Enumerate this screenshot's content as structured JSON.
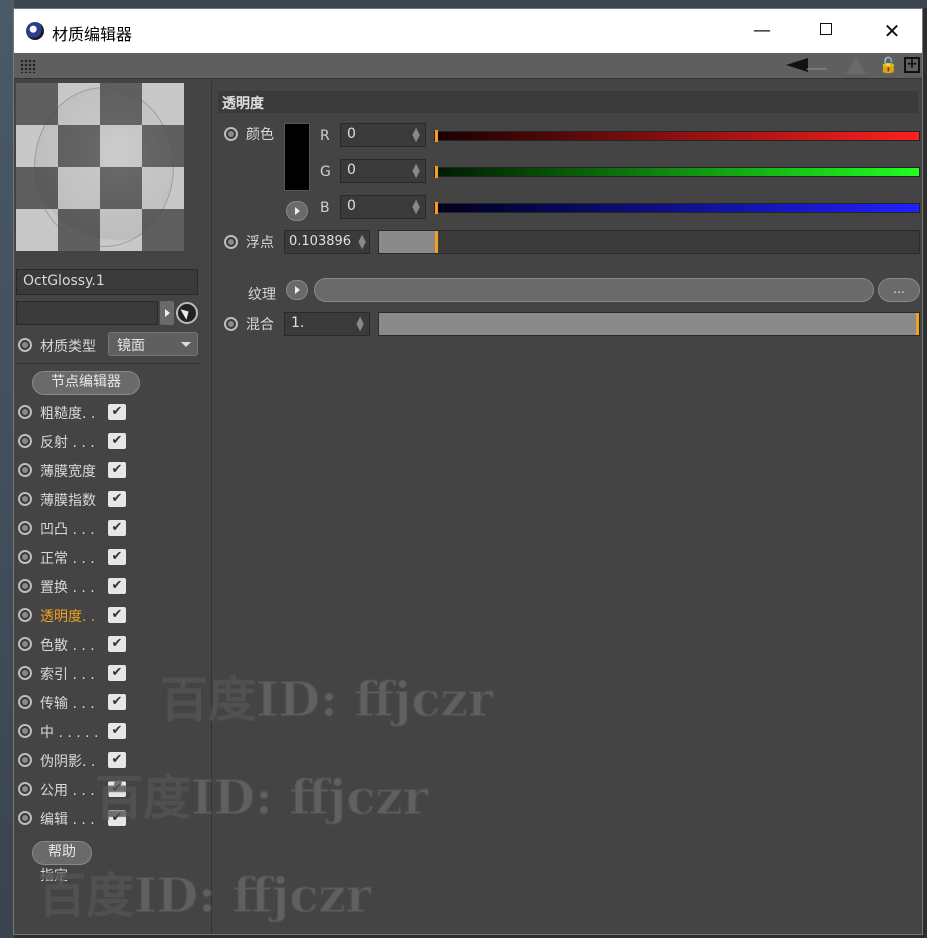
{
  "window": {
    "title": "材质编辑器",
    "minimize": "—",
    "close": "✕"
  },
  "toolbar": {
    "icons": [
      "grip-icon",
      "back-arrow-icon",
      "up-arrow-icon",
      "lock-icon",
      "new-window-icon"
    ]
  },
  "material": {
    "name": "OctGlossy.1",
    "type_label": "材质类型",
    "type_value": "镜面",
    "node_editor_button": "节点编辑器"
  },
  "channels": [
    {
      "label": "粗糙度. .",
      "checked": true,
      "active": false
    },
    {
      "label": "反射 . . .",
      "checked": true,
      "active": false
    },
    {
      "label": "薄膜宽度",
      "checked": true,
      "active": false
    },
    {
      "label": "薄膜指数",
      "checked": true,
      "active": false
    },
    {
      "label": "凹凸 . . .",
      "checked": true,
      "active": false
    },
    {
      "label": "正常 . . .",
      "checked": true,
      "active": false
    },
    {
      "label": "置换 . . .",
      "checked": true,
      "active": false
    },
    {
      "label": "透明度. .",
      "checked": true,
      "active": true
    },
    {
      "label": "色散 . . .",
      "checked": true,
      "active": false
    },
    {
      "label": "索引 . . .",
      "checked": true,
      "active": false
    },
    {
      "label": "传输 . . .",
      "checked": true,
      "active": false
    },
    {
      "label": "中 . . . . .",
      "checked": true,
      "active": false
    },
    {
      "label": "伪阴影. .",
      "checked": true,
      "active": false
    },
    {
      "label": "公用 . . .",
      "checked": true,
      "active": false
    },
    {
      "label": "编辑 . . .",
      "checked": true,
      "active": false
    }
  ],
  "check_glyph": "✔",
  "help_button": "帮助",
  "assign_label": "指定",
  "section": {
    "title": "透明度",
    "color_label": "颜色",
    "r_label": "R",
    "r_value": "0",
    "g_label": "G",
    "g_value": "0",
    "b_label": "B",
    "b_value": "0",
    "float_label": "浮点",
    "float_value": "0.103896",
    "float_fraction": 0.103896,
    "texture_label": "纹理",
    "texture_more": "...",
    "mix_label": "混合",
    "mix_value": "1.",
    "mix_fraction": 1.0
  },
  "colors": {
    "accent": "#f0a020",
    "red_channel": "#ff2020",
    "green_channel": "#20ff20",
    "blue_channel": "#2020ff"
  },
  "watermarks": [
    "百度ID: ffjczr",
    "百度ID: ffjczr",
    "百度ID: ffjczr"
  ]
}
